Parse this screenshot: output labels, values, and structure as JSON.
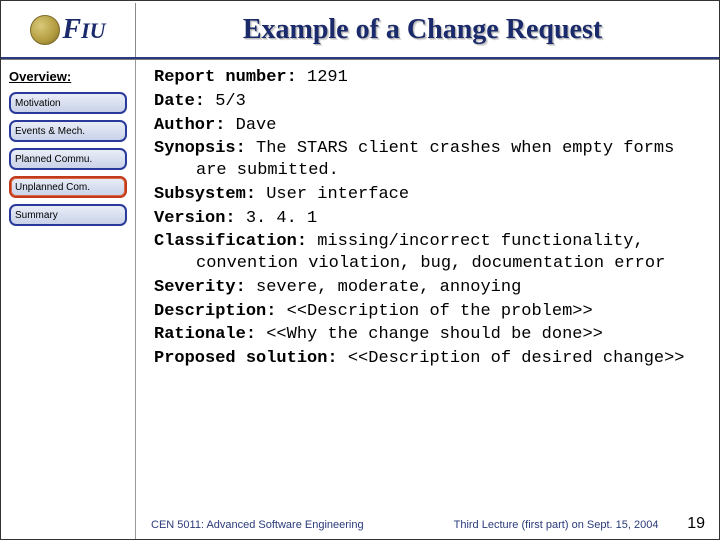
{
  "header": {
    "logo_text": "FIU",
    "title": "Example of a Change Request"
  },
  "sidebar": {
    "heading": "Overview:",
    "items": [
      {
        "label": "Motivation",
        "active": false
      },
      {
        "label": "Events & Mech.",
        "active": false
      },
      {
        "label": "Planned Commu.",
        "active": false
      },
      {
        "label": "Unplanned Com.",
        "active": true
      },
      {
        "label": "Summary",
        "active": false
      }
    ]
  },
  "report": {
    "fields": {
      "report_number_label": "Report number:",
      "report_number_value": " 1291",
      "date_label": "Date:",
      "date_value": " 5/3",
      "author_label": "Author:",
      "author_value": " Dave",
      "synopsis_label": "Synopsis:",
      "synopsis_value": " The STARS client crashes when empty forms are submitted.",
      "subsystem_label": "Subsystem:",
      "subsystem_value": " User interface",
      "version_label": "Version:",
      "version_value": " 3. 4. 1",
      "classification_label": "Classification:",
      "classification_value": "  missing/incorrect functionality, convention violation, bug, documentation error",
      "severity_label": "Severity:",
      "severity_value": " severe,  moderate,  annoying",
      "description_label": "Description:",
      "description_value": " <<Description of the problem>>",
      "rationale_label": "Rationale:",
      "rationale_value": " <<Why the change should be done>>",
      "proposed_label": "Proposed solution:",
      "proposed_value": " <<Description of desired change>>"
    }
  },
  "footer": {
    "course": "CEN 5011: Advanced Software Engineering",
    "lecture": "Third Lecture (first part) on Sept. 15, 2004",
    "page": "19"
  }
}
